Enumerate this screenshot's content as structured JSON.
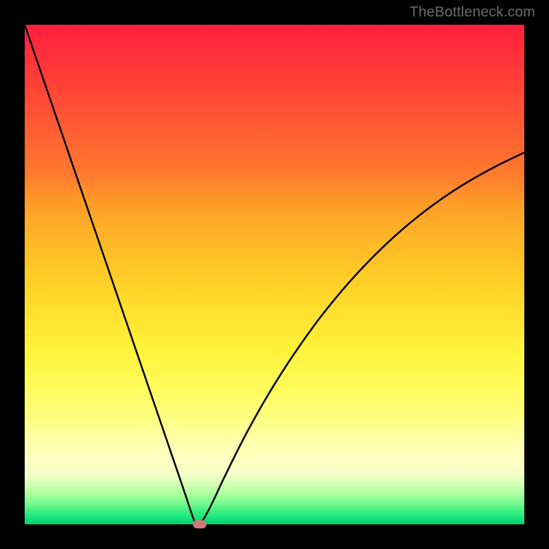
{
  "watermark": "TheBottleneck.com",
  "chart_data": {
    "type": "line",
    "title": "",
    "xlabel": "",
    "ylabel": "",
    "xlim": [
      0,
      100
    ],
    "ylim": [
      0,
      100
    ],
    "grid": false,
    "legend": false,
    "series": [
      {
        "name": "bottleneck-curve",
        "x": [
          0,
          4,
          8,
          12,
          16,
          20,
          24,
          28,
          32,
          34,
          35,
          37,
          40,
          44,
          48,
          52,
          56,
          60,
          65,
          70,
          75,
          80,
          85,
          90,
          95,
          100
        ],
        "y": [
          100,
          88.3,
          76.6,
          64.9,
          53.2,
          41.5,
          29.8,
          18.1,
          6.4,
          0.6,
          0,
          3.2,
          9.5,
          17.5,
          24.7,
          31.2,
          37.1,
          42.5,
          48.5,
          53.8,
          58.5,
          62.6,
          66.2,
          69.3,
          72.0,
          74.4
        ]
      }
    ],
    "marker": {
      "x_pct": 35,
      "y_pct": 0,
      "color": "#cf7a78"
    }
  }
}
